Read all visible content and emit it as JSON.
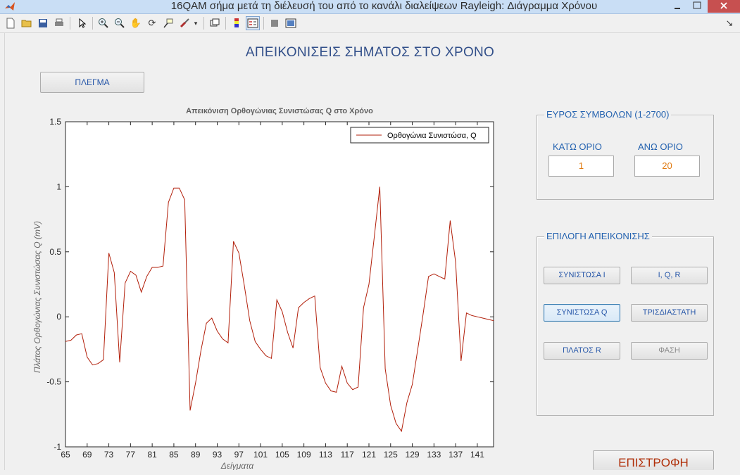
{
  "window": {
    "title": "16QAM σήμα μετά τη διέλευσή του από το κανάλι διαλείψεων Rayleigh: Διάγραμμα Χρόνου",
    "app_icon": "matlab-icon"
  },
  "toolbar": {
    "icons": [
      "new-file-icon",
      "open-folder-icon",
      "save-icon",
      "print-icon",
      "pointer-icon",
      "zoom-in-icon",
      "zoom-out-icon",
      "pan-hand-icon",
      "rotate-3d-icon",
      "data-cursor-icon",
      "brush-icon",
      "brush-dropdown-icon",
      "link-plot-icon",
      "colorbar-icon",
      "legend-icon",
      "hide-plot-tools-icon",
      "show-plot-tools-icon"
    ],
    "dock_icon": "dock-arrow-icon"
  },
  "page": {
    "heading": "ΑΠΕΙΚΟΝΙΣΕΙΣ ΣΗΜΑΤΟΣ ΣΤΟ ΧΡΟΝΟ",
    "grid_button": "ΠΛΕΓΜΑ",
    "return_button": "ΕΠΙΣΤΡΟΦΗ"
  },
  "symbol_range": {
    "title": "ΕΥΡΟΣ ΣΥΜΒΟΛΩΝ (1-2700)",
    "lower_label": "ΚΑΤΩ ΟΡΙΟ",
    "lower_value": "1",
    "upper_label": "ΑΝΩ ΟΡΙΟ",
    "upper_value": "20"
  },
  "display_select": {
    "title": "ΕΠΙΛΟΓΗ ΑΠΕΙΚΟΝΙΣΗΣ",
    "buttons": {
      "component_i": "ΣΥΝΙΣΤΩΣΑ Ι",
      "iqr": "I, Q, R",
      "component_q": "ΣΥΝΙΣΤΩΣΑ Q",
      "three_d": "ΤΡΙΣΔΙΑΣΤΑΤΗ",
      "amplitude_r": "ΠΛΑΤΟΣ R",
      "phase": "ΦΑΣΗ"
    }
  },
  "chart_data": {
    "type": "line",
    "title": "Απεικόνιση Ορθογώνιας Συνιστώσας Q στο Χρόνο",
    "xlabel": "Δείγματα",
    "ylabel": "Πλάτος Ορθογώνιας Συνιστώσας Q (mV)",
    "xlim": [
      65,
      144
    ],
    "ylim": [
      -1,
      1.5
    ],
    "xticks": [
      65,
      69,
      73,
      77,
      81,
      85,
      89,
      93,
      97,
      101,
      105,
      109,
      113,
      117,
      121,
      125,
      129,
      133,
      137,
      141
    ],
    "yticks": [
      -1,
      -0.5,
      0,
      0.5,
      1,
      1.5
    ],
    "grid": false,
    "legend_position": "top-right",
    "color": "#b21f0a",
    "series": [
      {
        "name": "Ορθογώνια Συνιστώσα, Q",
        "x": [
          65,
          66,
          67,
          68,
          69,
          70,
          71,
          72,
          73,
          74,
          75,
          76,
          77,
          78,
          79,
          80,
          81,
          82,
          83,
          84,
          85,
          86,
          87,
          88,
          89,
          90,
          91,
          92,
          93,
          94,
          95,
          96,
          97,
          98,
          99,
          100,
          101,
          102,
          103,
          104,
          105,
          106,
          107,
          108,
          109,
          110,
          111,
          112,
          113,
          114,
          115,
          116,
          117,
          118,
          119,
          120,
          121,
          122,
          123,
          124,
          125,
          126,
          127,
          128,
          129,
          130,
          131,
          132,
          133,
          134,
          135,
          136,
          137,
          138,
          139,
          140,
          141,
          142,
          143,
          144
        ],
        "values": [
          -0.19,
          -0.18,
          -0.14,
          -0.13,
          -0.31,
          -0.37,
          -0.36,
          -0.33,
          0.49,
          0.34,
          -0.35,
          0.26,
          0.35,
          0.32,
          0.19,
          0.31,
          0.38,
          0.38,
          0.39,
          0.88,
          0.99,
          0.99,
          0.9,
          -0.72,
          -0.51,
          -0.26,
          -0.05,
          -0.01,
          -0.11,
          -0.17,
          -0.2,
          0.58,
          0.49,
          0.24,
          -0.03,
          -0.19,
          -0.25,
          -0.3,
          -0.32,
          0.13,
          0.04,
          -0.12,
          -0.24,
          0.07,
          0.11,
          0.14,
          0.16,
          -0.39,
          -0.51,
          -0.57,
          -0.58,
          -0.38,
          -0.51,
          -0.56,
          -0.54,
          0.07,
          0.25,
          0.62,
          1.0,
          -0.4,
          -0.68,
          -0.82,
          -0.88,
          -0.66,
          -0.52,
          -0.25,
          0.02,
          0.31,
          0.33,
          0.31,
          0.29,
          0.74,
          0.42,
          -0.34,
          0.03,
          0.01,
          0.0,
          -0.01,
          -0.02,
          -0.03
        ]
      }
    ]
  }
}
